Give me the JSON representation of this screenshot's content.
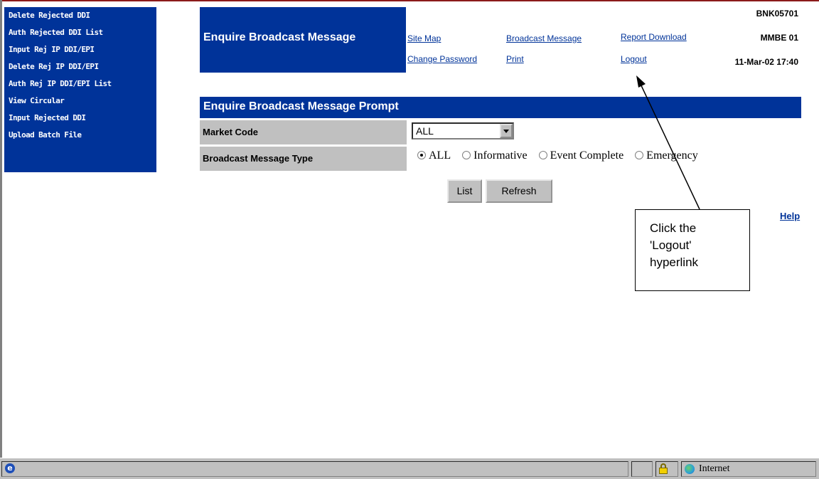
{
  "left_nav": {
    "items": [
      "Delete Rejected DDI",
      "Auth Rejected DDI List",
      "Input Rej IP DDI/EPI",
      "Delete Rej IP DDI/EPI",
      "Auth Rej IP DDI/EPI List",
      "View Circular",
      "Input Rejected DDI",
      "Upload Batch File"
    ]
  },
  "header": {
    "title": "Enquire Broadcast Message",
    "links": {
      "site_map": "Site Map",
      "broadcast_message": "Broadcast Message",
      "report_download": "Report Download",
      "change_password": "Change Password",
      "print": "Print",
      "logout": "Logout"
    },
    "info": {
      "user_id": "BNK05701",
      "terminal": "MMBE 01",
      "datetime": "11-Mar-02 17:40"
    }
  },
  "prompt": {
    "title": "Enquire Broadcast Message Prompt",
    "market_code_label": "Market Code",
    "market_code_value": "ALL",
    "broadcast_type_label": "Broadcast Message Type",
    "broadcast_type_options": [
      "ALL",
      "Informative",
      "Event Complete",
      "Emergency"
    ],
    "broadcast_type_selected": "ALL",
    "list_button": "List",
    "refresh_button": "Refresh",
    "help_link": "Help"
  },
  "callout": {
    "lines": [
      "Click the",
      "'Logout'",
      "hyperlink"
    ]
  },
  "status_bar": {
    "zone": "Internet"
  },
  "colors": {
    "nav_blue": "#003399",
    "label_gray": "#c0c0c0",
    "link_blue": "#003399"
  }
}
